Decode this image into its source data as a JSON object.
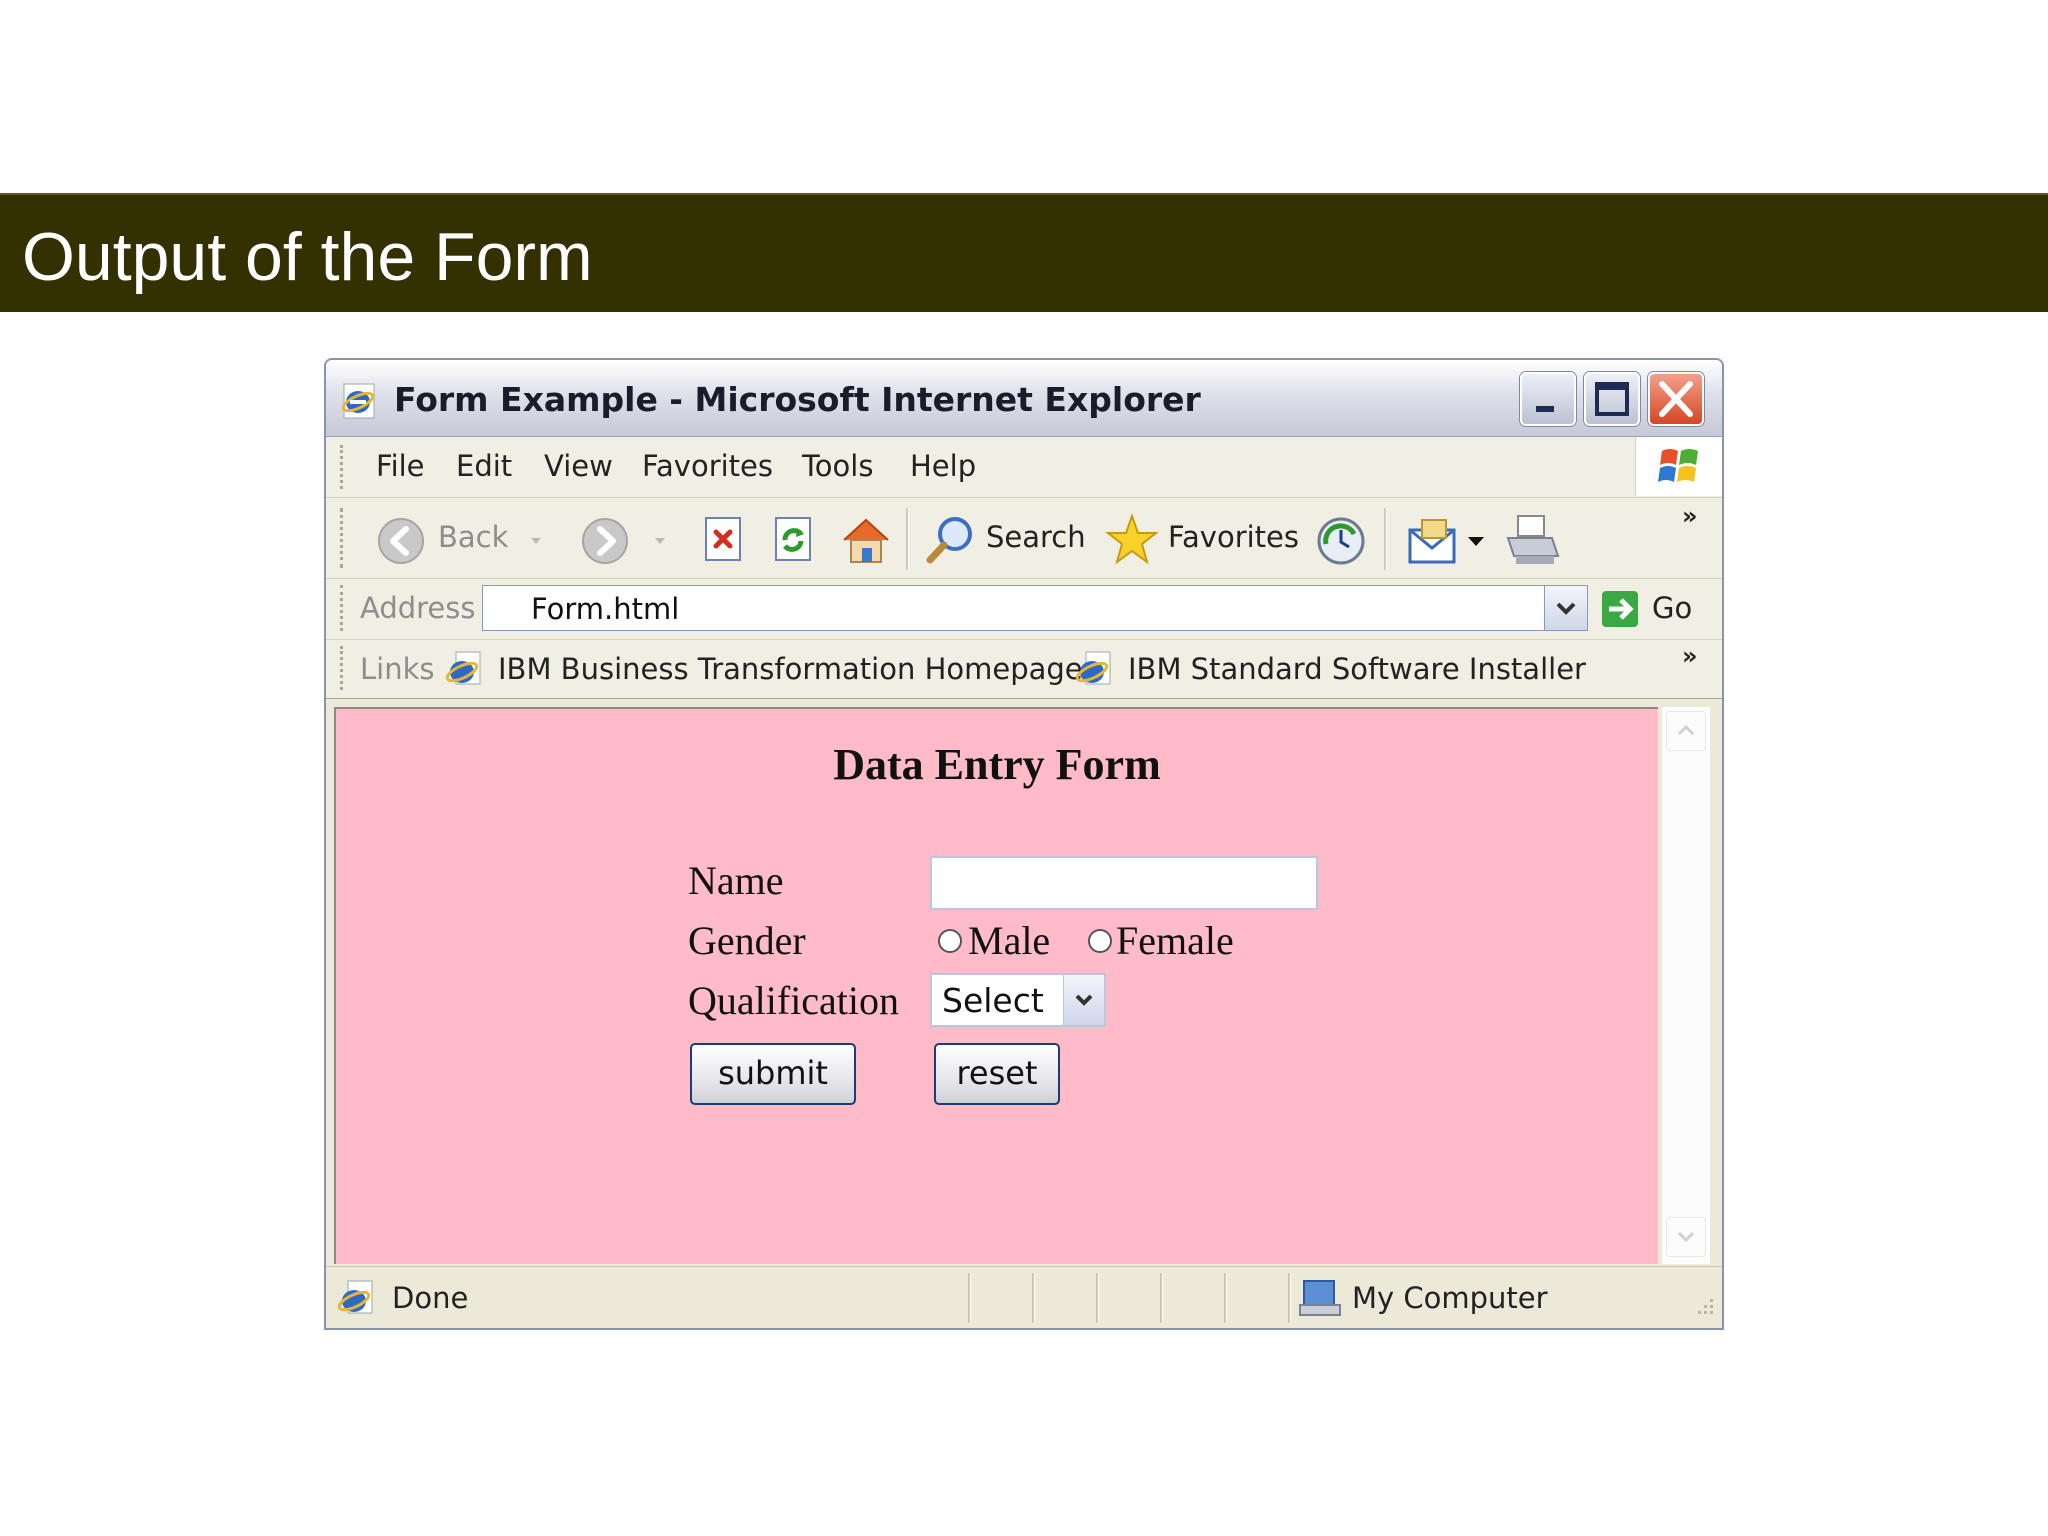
{
  "slide": {
    "title": "Output of the Form"
  },
  "window": {
    "title": "Form Example - Microsoft Internet Explorer",
    "menu": [
      "File",
      "Edit",
      "View",
      "Favorites",
      "Tools",
      "Help"
    ],
    "toolbar": {
      "back": "Back",
      "search": "Search",
      "favorites": "Favorites"
    },
    "address": {
      "label": "Address",
      "value": "Form.html",
      "go": "Go"
    },
    "links": {
      "label": "Links",
      "items": [
        "IBM Business Transformation Homepage",
        "IBM Standard Software Installer"
      ]
    },
    "status": {
      "text": "Done",
      "zone": "My Computer"
    }
  },
  "form": {
    "heading": "Data Entry Form",
    "name_label": "Name",
    "name_value": "",
    "gender_label": "Gender",
    "gender_options": [
      "Male",
      "Female"
    ],
    "qualification_label": "Qualification",
    "qualification_selected": "Select",
    "submit_label": "submit",
    "reset_label": "reset"
  },
  "colors": {
    "banner": "#333002",
    "page_background": "#ffbbc7"
  }
}
